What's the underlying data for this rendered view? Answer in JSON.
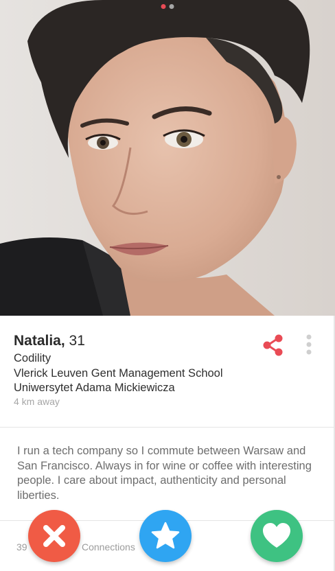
{
  "profile": {
    "name": "Natalia,",
    "age": "31",
    "company": "Codility",
    "school1": "Vlerick Leuven Gent Management School",
    "school2": "Uniwersytet Adama Mickiewicza",
    "distance": "4 km away"
  },
  "bio": {
    "text": "I run a tech company so I commute between Warsaw and San Francisco. Always in for wine or coffee with interesting people. I care about impact, authenticity and personal liberties."
  },
  "connections": {
    "count": "39",
    "label": "Connections"
  },
  "photo_pager": {
    "active_color": "#e94b55",
    "inactive_color": "#a6a6a6"
  },
  "actions": {
    "nope_icon": "close-icon",
    "superlike_icon": "star-icon",
    "like_icon": "heart-icon",
    "nope_color": "#f05b45",
    "superlike_color": "#2fa5f2",
    "like_color": "#3ec282",
    "share_icon_color": "#e94b55"
  }
}
